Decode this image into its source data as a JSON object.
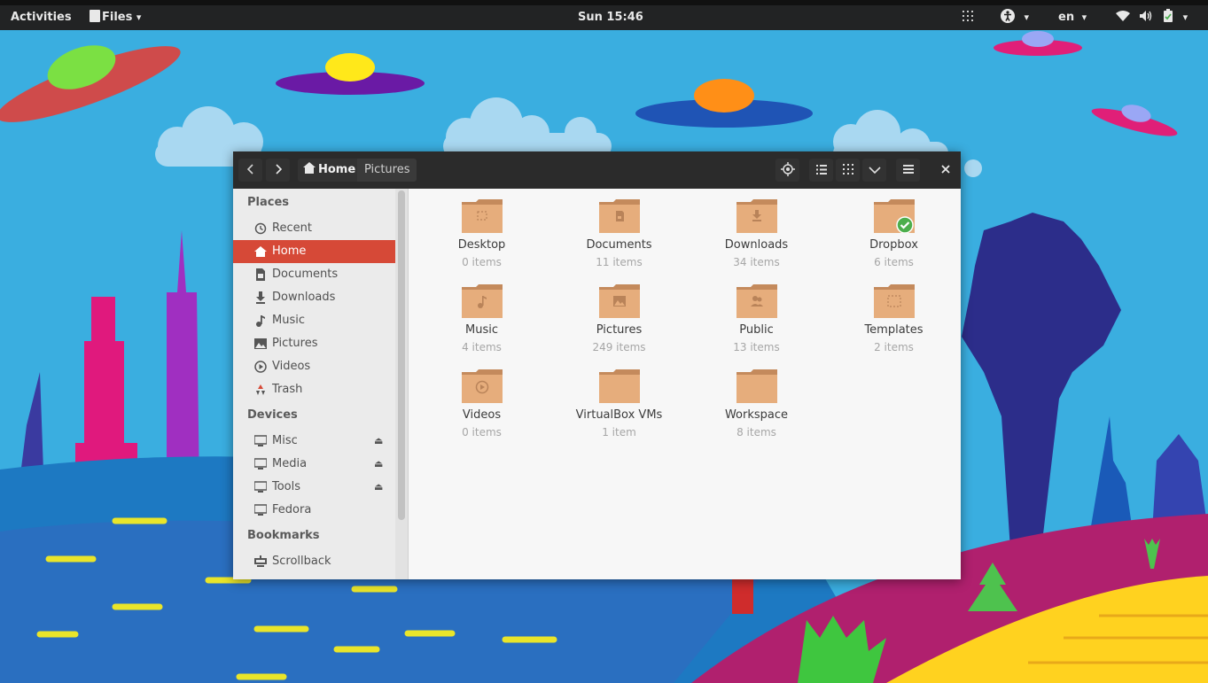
{
  "topbar": {
    "activities": "Activities",
    "app_menu": "Files",
    "clock": "Sun 15:46",
    "language": "en"
  },
  "window": {
    "path": [
      "Home",
      "Pictures"
    ],
    "sidebar": {
      "places_heading": "Places",
      "places": [
        {
          "label": "Recent",
          "icon": "clock-icon"
        },
        {
          "label": "Home",
          "icon": "home-icon",
          "active": true
        },
        {
          "label": "Documents",
          "icon": "document-icon"
        },
        {
          "label": "Downloads",
          "icon": "download-icon"
        },
        {
          "label": "Music",
          "icon": "music-note-icon"
        },
        {
          "label": "Pictures",
          "icon": "picture-icon"
        },
        {
          "label": "Videos",
          "icon": "play-circle-icon"
        },
        {
          "label": "Trash",
          "icon": "trash-icon"
        }
      ],
      "devices_heading": "Devices",
      "devices": [
        {
          "label": "Misc",
          "icon": "drive-icon",
          "eject": true
        },
        {
          "label": "Media",
          "icon": "drive-icon",
          "eject": true
        },
        {
          "label": "Tools",
          "icon": "drive-icon",
          "eject": true
        },
        {
          "label": "Fedora",
          "icon": "drive-icon",
          "eject": false
        }
      ],
      "bookmarks_heading": "Bookmarks",
      "bookmarks": [
        {
          "label": "Scrollback",
          "icon": "network-drive-icon"
        }
      ]
    },
    "items": [
      {
        "name": "Desktop",
        "count": "0 items",
        "emblem": "desktop"
      },
      {
        "name": "Documents",
        "count": "11 items",
        "emblem": "document"
      },
      {
        "name": "Downloads",
        "count": "34 items",
        "emblem": "download"
      },
      {
        "name": "Dropbox",
        "count": "6 items",
        "emblem": "check"
      },
      {
        "name": "Music",
        "count": "4 items",
        "emblem": "music"
      },
      {
        "name": "Pictures",
        "count": "249 items",
        "emblem": "picture"
      },
      {
        "name": "Public",
        "count": "13 items",
        "emblem": "people"
      },
      {
        "name": "Templates",
        "count": "2 items",
        "emblem": "template"
      },
      {
        "name": "Videos",
        "count": "0 items",
        "emblem": "video"
      },
      {
        "name": "VirtualBox VMs",
        "count": "1 item",
        "emblem": ""
      },
      {
        "name": "Workspace",
        "count": "8 items",
        "emblem": ""
      }
    ]
  },
  "colors": {
    "sidebar_active": "#d64937",
    "folder": "#e6ad7c",
    "headerbar": "#2b2b2b",
    "sky": "#3aaee0"
  }
}
